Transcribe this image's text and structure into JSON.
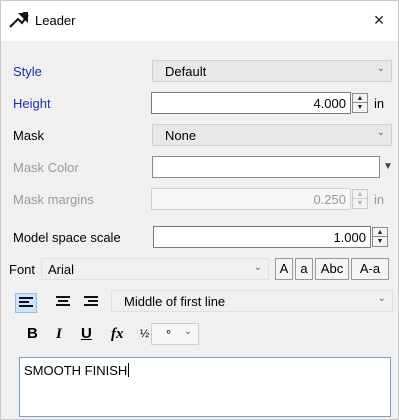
{
  "window": {
    "title": "Leader",
    "close_glyph": "×",
    "app_icon": "leader-arrow-icon"
  },
  "style": {
    "label": "Style",
    "value": "Default"
  },
  "height": {
    "label": "Height",
    "value": "4.000",
    "unit": "in"
  },
  "mask": {
    "label": "Mask",
    "value": "None"
  },
  "mask_color": {
    "label": "Mask Color"
  },
  "mask_margins": {
    "label": "Mask margins",
    "value": "0.250",
    "unit": "in"
  },
  "model_space_scale": {
    "label": "Model space scale",
    "value": "1.000"
  },
  "font": {
    "label": "Font",
    "value": "Arial"
  },
  "case_buttons": [
    "A",
    "a",
    "Abc",
    "A-a"
  ],
  "alignment": {
    "value": "Middle of first line",
    "icons": [
      "align-left-icon",
      "align-center-icon",
      "align-right-icon"
    ]
  },
  "format": {
    "bold": "B",
    "italic": "I",
    "underline": "U",
    "fx": "fx",
    "fraction": "½",
    "symbol": "°"
  },
  "text": {
    "value": "SMOOTH FINISH"
  },
  "colors": {
    "label_blue": "#1a2fa8",
    "disabled_gray": "#9a9a9a",
    "active_align": "#cde4fa"
  }
}
